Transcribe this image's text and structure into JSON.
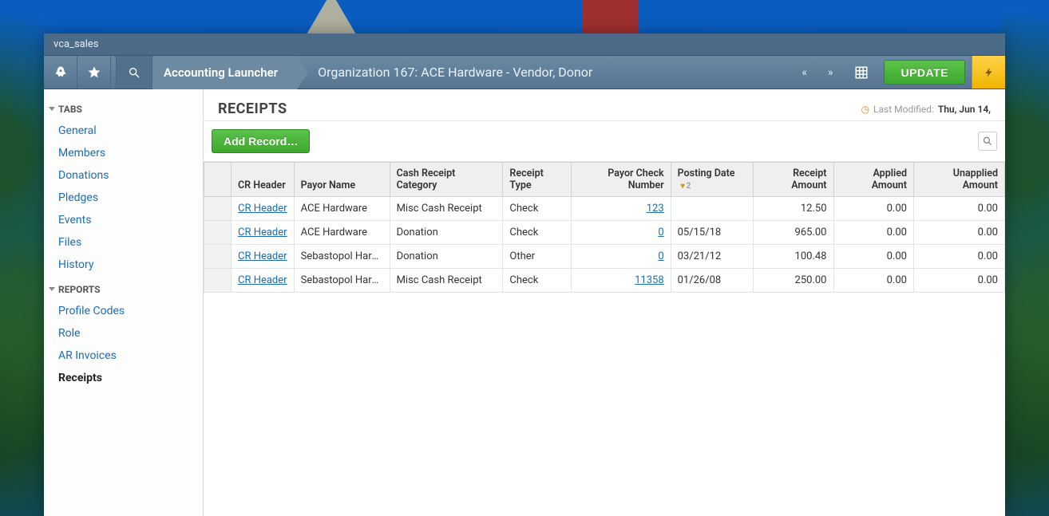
{
  "window": {
    "title": "vca_sales"
  },
  "toolbar": {
    "launcher_label": "Accounting Launcher",
    "detail_label": "Organization 167: ACE Hardware - Vendor, Donor",
    "update_label": "UPDATE"
  },
  "sidebar": {
    "tabs_header": "TABS",
    "reports_header": "REPORTS",
    "tabs": [
      {
        "label": "General"
      },
      {
        "label": "Members"
      },
      {
        "label": "Donations"
      },
      {
        "label": "Pledges"
      },
      {
        "label": "Events"
      },
      {
        "label": "Files"
      },
      {
        "label": "History"
      }
    ],
    "reports": [
      {
        "label": "Profile Codes"
      },
      {
        "label": "Role"
      },
      {
        "label": "AR Invoices"
      },
      {
        "label": "Receipts",
        "active": true
      }
    ]
  },
  "page": {
    "title": "RECEIPTS",
    "last_modified_label": "Last Modified:",
    "last_modified_date": "Thu, Jun 14,",
    "add_record_label": "Add Record…"
  },
  "grid": {
    "columns": {
      "cr_header": "CR Header",
      "payor_name": "Payor Name",
      "cash_receipt_category": "Cash Receipt Category",
      "receipt_type": "Receipt Type",
      "payor_check_number": "Payor Check Number",
      "posting_date": "Posting Date",
      "receipt_amount": "Receipt Amount",
      "applied_amount": "Applied Amount",
      "unapplied_amount": "Unapplied Amount"
    },
    "sort": {
      "column": "posting_date",
      "order_index": "2"
    },
    "rows": [
      {
        "cr_header": "CR Header",
        "payor_name": "ACE Hardware",
        "category": "Misc Cash Receipt",
        "receipt_type": "Check",
        "check_number": "123",
        "posting_date": "",
        "receipt_amount": "12.50",
        "applied_amount": "0.00",
        "unapplied_amount": "0.00"
      },
      {
        "cr_header": "CR Header",
        "payor_name": "ACE Hardware",
        "category": "Donation",
        "receipt_type": "Check",
        "check_number": "0",
        "posting_date": "05/15/18",
        "receipt_amount": "965.00",
        "applied_amount": "0.00",
        "unapplied_amount": "0.00"
      },
      {
        "cr_header": "CR Header",
        "payor_name": "Sebastopol Hard…",
        "category": "Donation",
        "receipt_type": "Other",
        "check_number": "0",
        "posting_date": "03/21/12",
        "receipt_amount": "100.48",
        "applied_amount": "0.00",
        "unapplied_amount": "0.00"
      },
      {
        "cr_header": "CR Header",
        "payor_name": "Sebastopol Hard…",
        "category": "Misc Cash Receipt",
        "receipt_type": "Check",
        "check_number": "11358",
        "posting_date": "01/26/08",
        "receipt_amount": "250.00",
        "applied_amount": "0.00",
        "unapplied_amount": "0.00"
      }
    ]
  }
}
